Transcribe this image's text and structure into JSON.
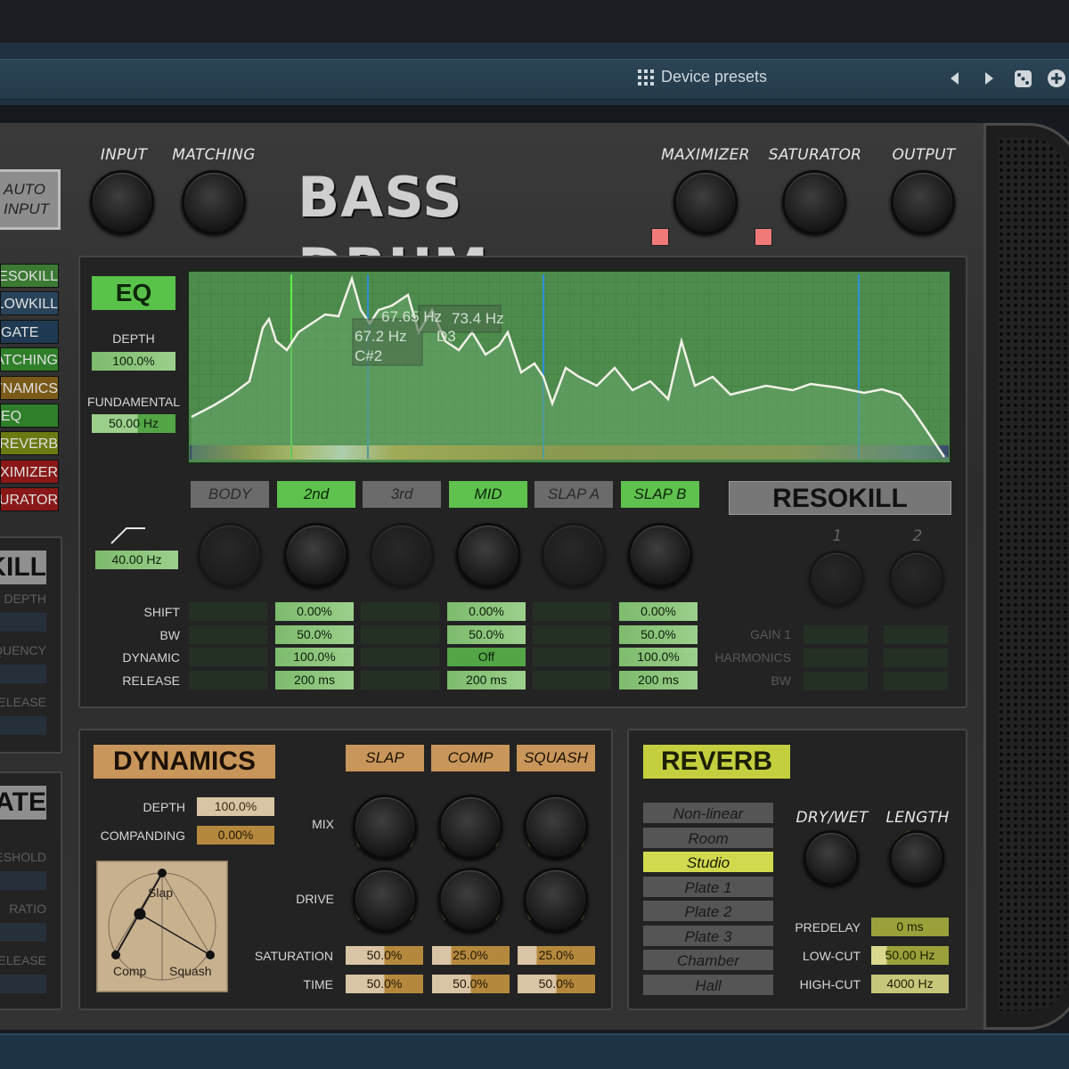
{
  "host": {
    "presets_label": "Device presets",
    "icons": [
      "grid-icon",
      "prev-arrow-icon",
      "next-arrow-icon",
      "random-dice-icon",
      "add-icon"
    ]
  },
  "header": {
    "title": "BASS DRUM",
    "auto_input": "AUTO INPUT",
    "knobs": {
      "input": "INPUT",
      "matching": "MATCHING",
      "maximizer": "MAXIMIZER",
      "saturator": "SATURATOR",
      "output": "OUTPUT"
    }
  },
  "sidebar": {
    "modules": [
      {
        "label": "RESOKILL",
        "color": "#3c7a34"
      },
      {
        "label": "LOWKILL",
        "color": "#29435a"
      },
      {
        "label": "GATE",
        "color": "#1f3a52"
      },
      {
        "label": "MATCHING",
        "color": "#2f7f2a"
      },
      {
        "label": "DYNAMICS",
        "color": "#7a5a18"
      },
      {
        "label": "EQ",
        "color": "#2f7f2a"
      },
      {
        "label": "REVERB",
        "color": "#6b7a12"
      },
      {
        "label": "MAXIMIZER",
        "color": "#8a1818"
      },
      {
        "label": "SATURATOR",
        "color": "#8a1818"
      }
    ],
    "lowkill": {
      "title": "LOWKILL",
      "labels": [
        "DEPTH",
        "FREQUENCY",
        "RELEASE"
      ]
    },
    "gate": {
      "title": "GATE",
      "labels": [
        "THRESHOLD",
        "RATIO",
        "RELEASE"
      ]
    }
  },
  "eq": {
    "title": "EQ",
    "depth_label": "DEPTH",
    "depth_value": "100.0%",
    "fundamental_label": "FUNDAMENTAL",
    "fundamental_value": "50.00 Hz",
    "highpass_value": "40.00 Hz",
    "markers": [
      "67.65 Hz",
      "67.2 Hz",
      "C#2",
      "73.4 Hz",
      "D3"
    ],
    "bands": [
      {
        "name": "BODY",
        "on": false,
        "shift": "",
        "bw": "",
        "dynamic": "",
        "release": ""
      },
      {
        "name": "2nd",
        "on": true,
        "shift": "0.00%",
        "bw": "50.0%",
        "dynamic": "100.0%",
        "release": "200 ms"
      },
      {
        "name": "3rd",
        "on": false,
        "shift": "",
        "bw": "",
        "dynamic": "",
        "release": ""
      },
      {
        "name": "MID",
        "on": true,
        "shift": "0.00%",
        "bw": "50.0%",
        "dynamic": "Off",
        "release": "200 ms"
      },
      {
        "name": "SLAP A",
        "on": false,
        "shift": "",
        "bw": "",
        "dynamic": "",
        "release": ""
      },
      {
        "name": "SLAP B",
        "on": true,
        "shift": "0.00%",
        "bw": "50.0%",
        "dynamic": "100.0%",
        "release": "200 ms"
      }
    ],
    "row_labels": [
      "SHIFT",
      "BW",
      "DYNAMIC",
      "RELEASE"
    ]
  },
  "resokill": {
    "title": "RESOKILL",
    "knob_labels": [
      "1",
      "2"
    ],
    "row_labels": [
      "GAIN 1",
      "HARMONICS",
      "BW"
    ]
  },
  "dynamics": {
    "title": "DYNAMICS",
    "depth_label": "DEPTH",
    "depth_value": "100.0%",
    "companding_label": "COMPANDING",
    "companding_value": "0.00%",
    "modes": [
      "SLAP",
      "COMP",
      "SQUASH"
    ],
    "mix_label": "MIX",
    "drive_label": "DRIVE",
    "saturation_label": "SATURATION",
    "time_label": "TIME",
    "saturation_values": [
      "50.0%",
      "25.0%",
      "25.0%"
    ],
    "time_values": [
      "50.0%",
      "50.0%",
      "50.0%"
    ],
    "xy_labels": {
      "slap": "Slap",
      "comp": "Comp",
      "squash": "Squash"
    }
  },
  "reverb": {
    "title": "REVERB",
    "types": [
      "Non-linear",
      "Room",
      "Studio",
      "Plate 1",
      "Plate 2",
      "Plate 3",
      "Chamber",
      "Hall"
    ],
    "selected": "Studio",
    "drywet_label": "DRY/WET",
    "length_label": "LENGTH",
    "predelay_label": "PREDELAY",
    "predelay_value": "0 ms",
    "lowcut_label": "LOW-CUT",
    "lowcut_value": "50.00 Hz",
    "highcut_label": "HIGH-CUT",
    "highcut_value": "4000 Hz"
  },
  "colors": {
    "eq_green": "#59c24a",
    "dynamics_tan": "#c8965a",
    "reverb_yellow": "#c3cf3e",
    "host_blue": "#243b4a"
  }
}
